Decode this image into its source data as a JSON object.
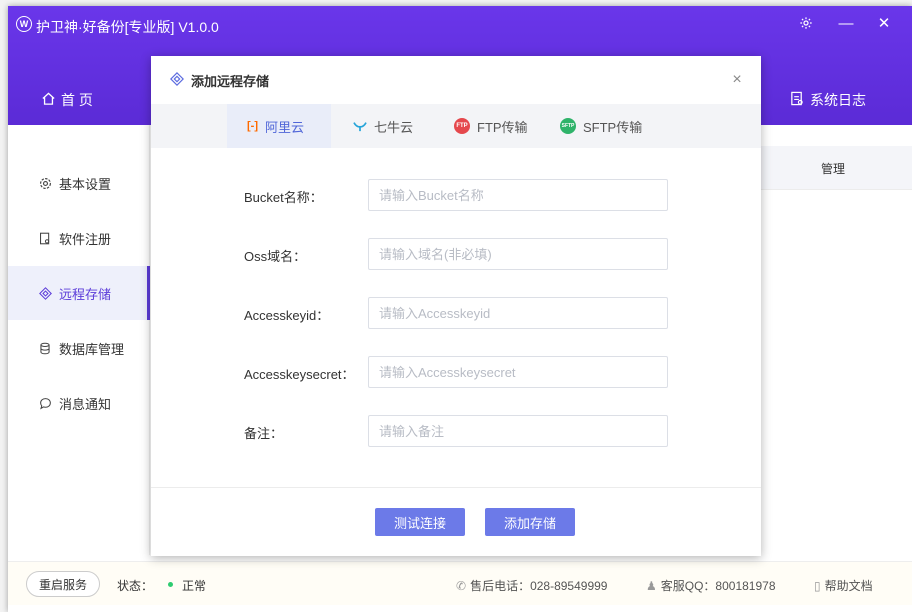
{
  "window": {
    "title": "护卫神·好备份[专业版]  V1.0.0",
    "logo_text": "W",
    "settings_icon": "gear-icon",
    "minimize_glyph": "—",
    "close_glyph": "✕"
  },
  "nav": {
    "home_label": "首  页",
    "log_label": "系统日志"
  },
  "sidebar": {
    "items": [
      {
        "label": "基本设置",
        "icon": "gear-icon"
      },
      {
        "label": "软件注册",
        "icon": "register-icon"
      },
      {
        "label": "远程存储",
        "icon": "remote-storage-icon"
      },
      {
        "label": "数据库管理",
        "icon": "database-icon"
      },
      {
        "label": "消息通知",
        "icon": "message-icon"
      }
    ],
    "active_index": 2
  },
  "main": {
    "column_header": "管理"
  },
  "statusbar": {
    "restart_label": "重启服务",
    "status_label": "状态：",
    "status_value": "正常",
    "status_color": "#2ecc71",
    "phone": "售后电话：028-89549999",
    "qq": "客服QQ：800181978",
    "help": "帮助文档"
  },
  "modal": {
    "title": "添加远程存储",
    "close_glyph": "×",
    "tabs": [
      {
        "label": "阿里云",
        "icon": "aliyun-icon",
        "icon_text": "[-]"
      },
      {
        "label": "七牛云",
        "icon": "qiniu-icon",
        "icon_text": ""
      },
      {
        "label": "FTP传输",
        "icon": "ftp-icon",
        "icon_text": "FTP"
      },
      {
        "label": "SFTP传输",
        "icon": "sftp-icon",
        "icon_text": "SFTP"
      }
    ],
    "active_tab": 0,
    "fields": [
      {
        "label": "Bucket名称：",
        "placeholder": "请输入Bucket名称",
        "value": ""
      },
      {
        "label": "Oss域名：",
        "placeholder": "请输入域名(非必填)",
        "value": ""
      },
      {
        "label": "Accesskeyid：",
        "placeholder": "请输入Accesskeyid",
        "value": ""
      },
      {
        "label": "Accesskeysecret：",
        "placeholder": "请输入Accesskeysecret",
        "value": ""
      },
      {
        "label": "备注：",
        "placeholder": "请输入备注",
        "value": ""
      }
    ],
    "test_button": "测试连接",
    "add_button": "添加存储"
  },
  "colors": {
    "header": "#5b2bd6",
    "accent": "#6c7ae8",
    "tab_active_text": "#5066d8"
  }
}
